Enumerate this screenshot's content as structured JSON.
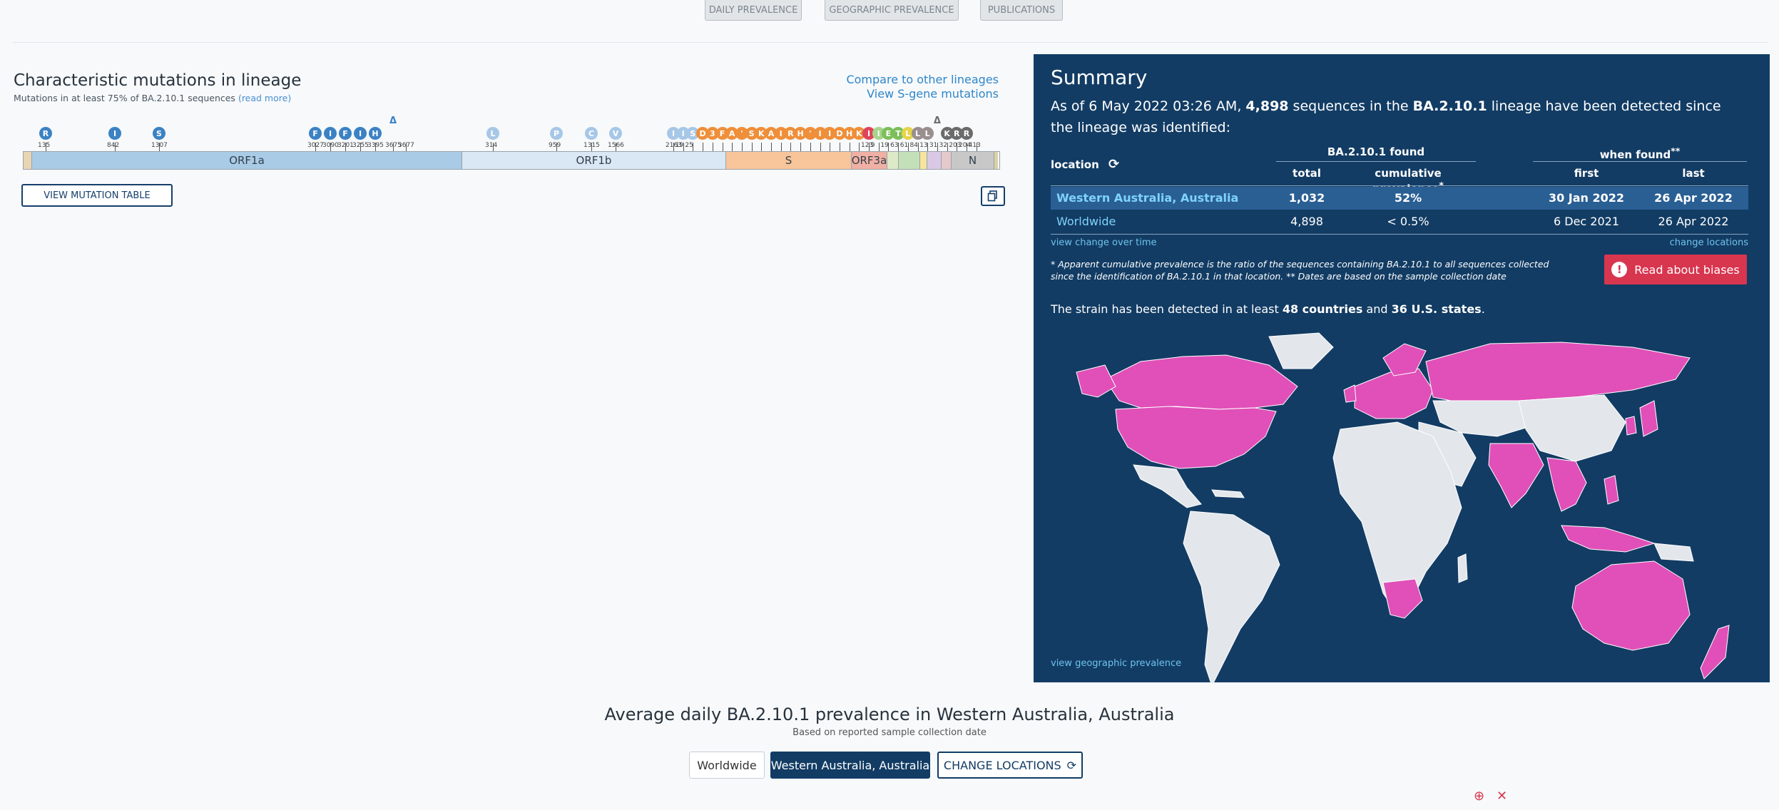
{
  "nav": {
    "daily": "DAILY PREVALENCE",
    "geo": "GEOGRAPHIC PREVALENCE",
    "pubs": "PUBLICATIONS"
  },
  "mutations": {
    "title": "Characteristic mutations in lineage",
    "subtitle": "Mutations in at least 75% of BA.2.10.1 sequences",
    "read_more": "(read more)",
    "compare_link": "Compare to other lineages",
    "sgene_link": "View S-gene mutations",
    "view_table": "VIEW MUTATION TABLE",
    "genes": [
      "ORF1a",
      "ORF1b",
      "S",
      "ORF3a",
      "N"
    ],
    "orf1a_markers": [
      {
        "label": "R",
        "pos": "135"
      },
      {
        "label": "I",
        "pos": "842"
      },
      {
        "label": "S",
        "pos": "1307"
      },
      {
        "label": "F",
        "pos": "3027"
      },
      {
        "label": "I",
        "pos": "3090"
      },
      {
        "label": "F",
        "pos": "3201"
      },
      {
        "label": "I",
        "pos": "3255"
      },
      {
        "label": "H",
        "pos": "3395"
      },
      {
        "label": "Δ",
        "pos": "3675"
      },
      {
        "label": "",
        "pos": "3677"
      }
    ],
    "orf1b_markers": [
      {
        "label": "L",
        "pos": "314"
      },
      {
        "label": "P",
        "pos": "959"
      },
      {
        "label": "C",
        "pos": "1315"
      },
      {
        "label": "V",
        "pos": "1566"
      }
    ],
    "right_markers": [
      {
        "label": "I",
        "pos": "2163"
      },
      {
        "label": "I",
        "pos": "19"
      },
      {
        "label": "S",
        "pos": "25"
      },
      {
        "label": "D",
        "pos": ""
      },
      {
        "label": "3",
        "pos": ""
      },
      {
        "label": "F",
        "pos": ""
      },
      {
        "label": "A",
        "pos": ""
      },
      {
        "label": "'",
        "pos": ""
      },
      {
        "label": "S",
        "pos": ""
      },
      {
        "label": "K",
        "pos": ""
      },
      {
        "label": "A",
        "pos": ""
      },
      {
        "label": "I",
        "pos": ""
      },
      {
        "label": "R",
        "pos": ""
      },
      {
        "label": "H",
        "pos": ""
      },
      {
        "label": "'",
        "pos": ""
      },
      {
        "label": "I",
        "pos": ""
      },
      {
        "label": "I",
        "pos": ""
      },
      {
        "label": "D",
        "pos": ""
      },
      {
        "label": "H",
        "pos": ""
      },
      {
        "label": "K",
        "pos": ""
      },
      {
        "label": "I",
        "pos": "123"
      },
      {
        "label": "I",
        "pos": "9"
      },
      {
        "label": "E",
        "pos": "19"
      },
      {
        "label": "T",
        "pos": "63"
      },
      {
        "label": "L",
        "pos": "61"
      },
      {
        "label": "L",
        "pos": "84"
      },
      {
        "label": "L",
        "pos": "13"
      },
      {
        "label": "Δ",
        "pos": "31"
      },
      {
        "label": "K",
        "pos": "32"
      },
      {
        "label": "R",
        "pos": "203"
      },
      {
        "label": "R",
        "pos": "204"
      },
      {
        "label": "",
        "pos": "413"
      }
    ]
  },
  "summary": {
    "title": "Summary",
    "text_prefix": "As of 6 May 2022 03:26 AM, ",
    "text_count": "4,898",
    "text_mid": " sequences in the ",
    "text_lineage": "BA.2.10.1",
    "text_suffix": " lineage have been detected since the lineage was identified:",
    "header_location": "location",
    "header_found": "BA.2.10.1 found",
    "header_when": "when found",
    "header_total": "total",
    "header_cum": "cumulative prevalence",
    "header_first": "first",
    "header_last": "last",
    "rows": [
      {
        "location": "Western Australia, Australia",
        "total": "1,032",
        "cum": "52%",
        "first": "30 Jan 2022",
        "last": "26 Apr 2022"
      },
      {
        "location": "Worldwide",
        "total": "4,898",
        "cum": "< 0.5%",
        "first": "6 Dec 2021",
        "last": "26 Apr 2022"
      }
    ],
    "view_change": "view change over time",
    "change_locations": "change locations",
    "note": "* Apparent cumulative prevalence is the ratio of the sequences containing BA.2.10.1 to all sequences collected since the identification of BA.2.10.1 in that location.  ** Dates are based on the sample collection date",
    "bias_button": "Read about biases",
    "detect_prefix": "The strain has been detected in at least ",
    "detect_countries": "48 countries",
    "detect_and": " and ",
    "detect_states": "36 U.S. states",
    "detect_end": ".",
    "view_geo": "view geographic prevalence"
  },
  "bottom": {
    "title": "Average daily BA.2.10.1 prevalence in Western Australia, Australia",
    "subtitle": "Based on reported sample collection date",
    "btn_worldwide": "Worldwide",
    "btn_wa": "Western Australia, Australia",
    "btn_change": "CHANGE LOCATIONS"
  },
  "colors": {
    "navy": "#123c64",
    "magenta": "#e050b8",
    "land": "#e3e7ec",
    "bias": "#d8354f"
  }
}
